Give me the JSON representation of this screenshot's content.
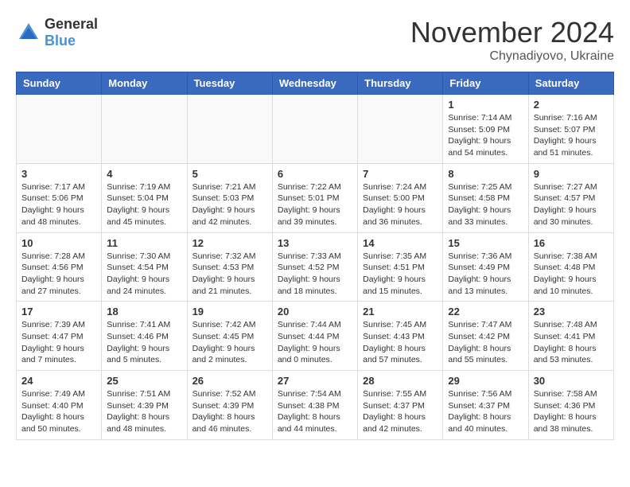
{
  "header": {
    "logo_general": "General",
    "logo_blue": "Blue",
    "month_title": "November 2024",
    "location": "Chynadiyovo, Ukraine"
  },
  "days_of_week": [
    "Sunday",
    "Monday",
    "Tuesday",
    "Wednesday",
    "Thursday",
    "Friday",
    "Saturday"
  ],
  "weeks": [
    [
      {
        "day": "",
        "info": ""
      },
      {
        "day": "",
        "info": ""
      },
      {
        "day": "",
        "info": ""
      },
      {
        "day": "",
        "info": ""
      },
      {
        "day": "",
        "info": ""
      },
      {
        "day": "1",
        "info": "Sunrise: 7:14 AM\nSunset: 5:09 PM\nDaylight: 9 hours and 54 minutes."
      },
      {
        "day": "2",
        "info": "Sunrise: 7:16 AM\nSunset: 5:07 PM\nDaylight: 9 hours and 51 minutes."
      }
    ],
    [
      {
        "day": "3",
        "info": "Sunrise: 7:17 AM\nSunset: 5:06 PM\nDaylight: 9 hours and 48 minutes."
      },
      {
        "day": "4",
        "info": "Sunrise: 7:19 AM\nSunset: 5:04 PM\nDaylight: 9 hours and 45 minutes."
      },
      {
        "day": "5",
        "info": "Sunrise: 7:21 AM\nSunset: 5:03 PM\nDaylight: 9 hours and 42 minutes."
      },
      {
        "day": "6",
        "info": "Sunrise: 7:22 AM\nSunset: 5:01 PM\nDaylight: 9 hours and 39 minutes."
      },
      {
        "day": "7",
        "info": "Sunrise: 7:24 AM\nSunset: 5:00 PM\nDaylight: 9 hours and 36 minutes."
      },
      {
        "day": "8",
        "info": "Sunrise: 7:25 AM\nSunset: 4:58 PM\nDaylight: 9 hours and 33 minutes."
      },
      {
        "day": "9",
        "info": "Sunrise: 7:27 AM\nSunset: 4:57 PM\nDaylight: 9 hours and 30 minutes."
      }
    ],
    [
      {
        "day": "10",
        "info": "Sunrise: 7:28 AM\nSunset: 4:56 PM\nDaylight: 9 hours and 27 minutes."
      },
      {
        "day": "11",
        "info": "Sunrise: 7:30 AM\nSunset: 4:54 PM\nDaylight: 9 hours and 24 minutes."
      },
      {
        "day": "12",
        "info": "Sunrise: 7:32 AM\nSunset: 4:53 PM\nDaylight: 9 hours and 21 minutes."
      },
      {
        "day": "13",
        "info": "Sunrise: 7:33 AM\nSunset: 4:52 PM\nDaylight: 9 hours and 18 minutes."
      },
      {
        "day": "14",
        "info": "Sunrise: 7:35 AM\nSunset: 4:51 PM\nDaylight: 9 hours and 15 minutes."
      },
      {
        "day": "15",
        "info": "Sunrise: 7:36 AM\nSunset: 4:49 PM\nDaylight: 9 hours and 13 minutes."
      },
      {
        "day": "16",
        "info": "Sunrise: 7:38 AM\nSunset: 4:48 PM\nDaylight: 9 hours and 10 minutes."
      }
    ],
    [
      {
        "day": "17",
        "info": "Sunrise: 7:39 AM\nSunset: 4:47 PM\nDaylight: 9 hours and 7 minutes."
      },
      {
        "day": "18",
        "info": "Sunrise: 7:41 AM\nSunset: 4:46 PM\nDaylight: 9 hours and 5 minutes."
      },
      {
        "day": "19",
        "info": "Sunrise: 7:42 AM\nSunset: 4:45 PM\nDaylight: 9 hours and 2 minutes."
      },
      {
        "day": "20",
        "info": "Sunrise: 7:44 AM\nSunset: 4:44 PM\nDaylight: 9 hours and 0 minutes."
      },
      {
        "day": "21",
        "info": "Sunrise: 7:45 AM\nSunset: 4:43 PM\nDaylight: 8 hours and 57 minutes."
      },
      {
        "day": "22",
        "info": "Sunrise: 7:47 AM\nSunset: 4:42 PM\nDaylight: 8 hours and 55 minutes."
      },
      {
        "day": "23",
        "info": "Sunrise: 7:48 AM\nSunset: 4:41 PM\nDaylight: 8 hours and 53 minutes."
      }
    ],
    [
      {
        "day": "24",
        "info": "Sunrise: 7:49 AM\nSunset: 4:40 PM\nDaylight: 8 hours and 50 minutes."
      },
      {
        "day": "25",
        "info": "Sunrise: 7:51 AM\nSunset: 4:39 PM\nDaylight: 8 hours and 48 minutes."
      },
      {
        "day": "26",
        "info": "Sunrise: 7:52 AM\nSunset: 4:39 PM\nDaylight: 8 hours and 46 minutes."
      },
      {
        "day": "27",
        "info": "Sunrise: 7:54 AM\nSunset: 4:38 PM\nDaylight: 8 hours and 44 minutes."
      },
      {
        "day": "28",
        "info": "Sunrise: 7:55 AM\nSunset: 4:37 PM\nDaylight: 8 hours and 42 minutes."
      },
      {
        "day": "29",
        "info": "Sunrise: 7:56 AM\nSunset: 4:37 PM\nDaylight: 8 hours and 40 minutes."
      },
      {
        "day": "30",
        "info": "Sunrise: 7:58 AM\nSunset: 4:36 PM\nDaylight: 8 hours and 38 minutes."
      }
    ]
  ]
}
